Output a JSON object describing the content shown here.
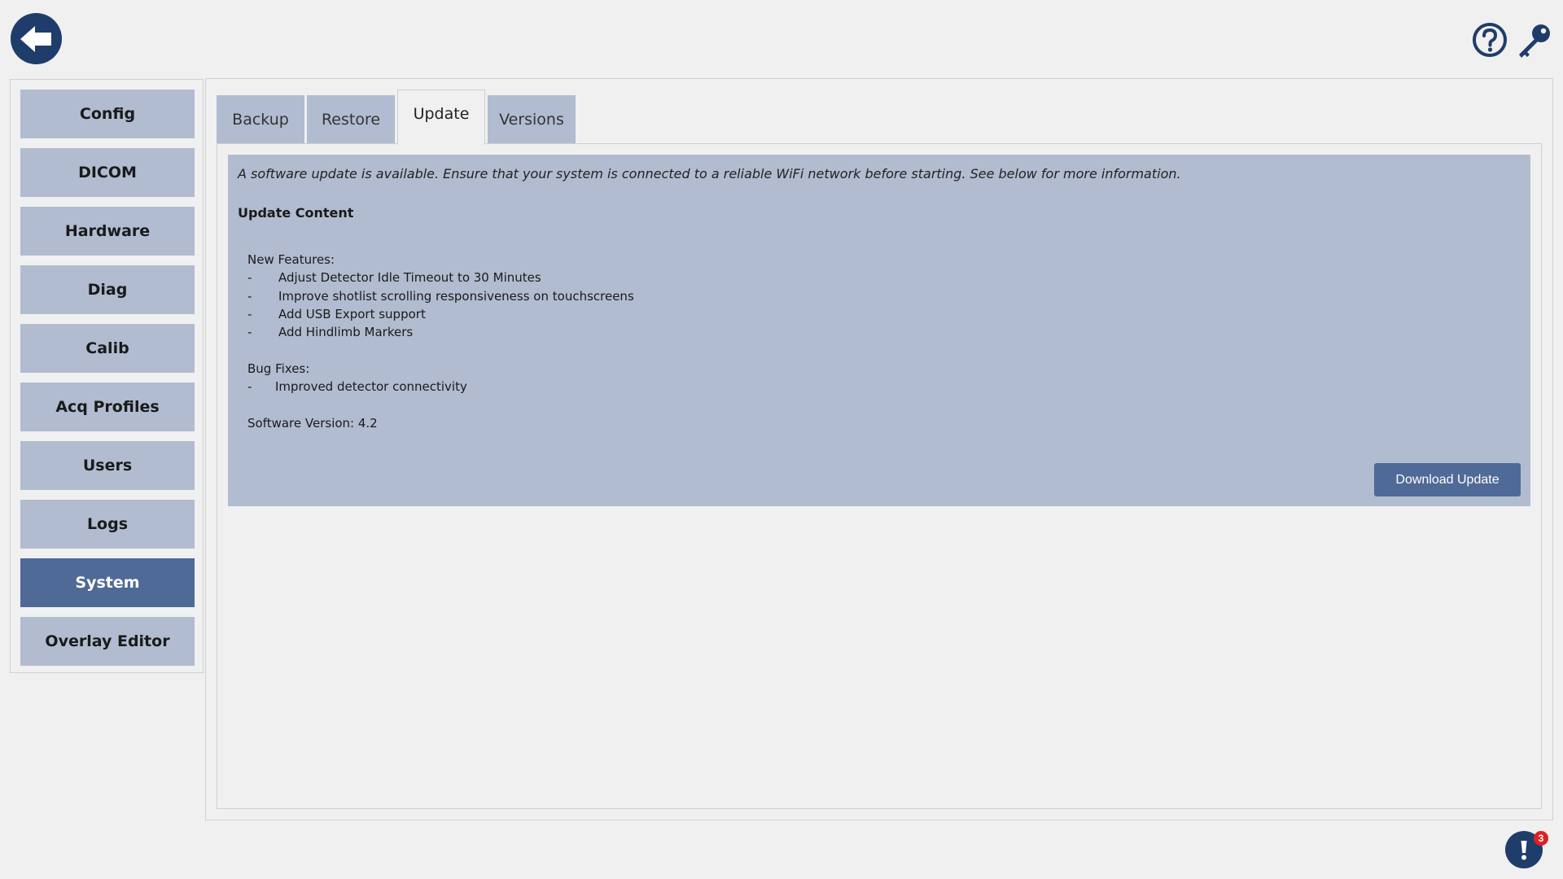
{
  "sidebar": {
    "items": [
      {
        "label": "Config"
      },
      {
        "label": "DICOM"
      },
      {
        "label": "Hardware"
      },
      {
        "label": "Diag"
      },
      {
        "label": "Calib"
      },
      {
        "label": "Acq Profiles"
      },
      {
        "label": "Users"
      },
      {
        "label": "Logs"
      },
      {
        "label": "System",
        "active": true
      },
      {
        "label": "Overlay Editor"
      }
    ]
  },
  "tabs": [
    {
      "label": "Backup"
    },
    {
      "label": "Restore"
    },
    {
      "label": "Update",
      "active": true
    },
    {
      "label": "Versions"
    }
  ],
  "update": {
    "notice": "A software update is available. Ensure that your system is connected to a reliable WiFi network before starting. See below for more information.",
    "section_title": "Update Content",
    "new_features_label": "New Features:",
    "bullet": "-",
    "new_features": [
      "Adjust Detector Idle Timeout to 30 Minutes",
      "Improve shotlist scrolling responsiveness on touchscreens",
      "Add USB Export support",
      "Add Hindlimb Markers"
    ],
    "bug_fixes_label": "Bug Fixes:",
    "bug_fixes": [
      "Improved detector connectivity"
    ],
    "software_version": "Software Version: 4.2",
    "download_label": "Download Update"
  },
  "notifications": {
    "count": "3"
  },
  "colors": {
    "accent": "#4f6a96",
    "nav_bg": "#b1bcd0",
    "icon_navy": "#1f3d6b",
    "badge_red": "#e02020"
  }
}
